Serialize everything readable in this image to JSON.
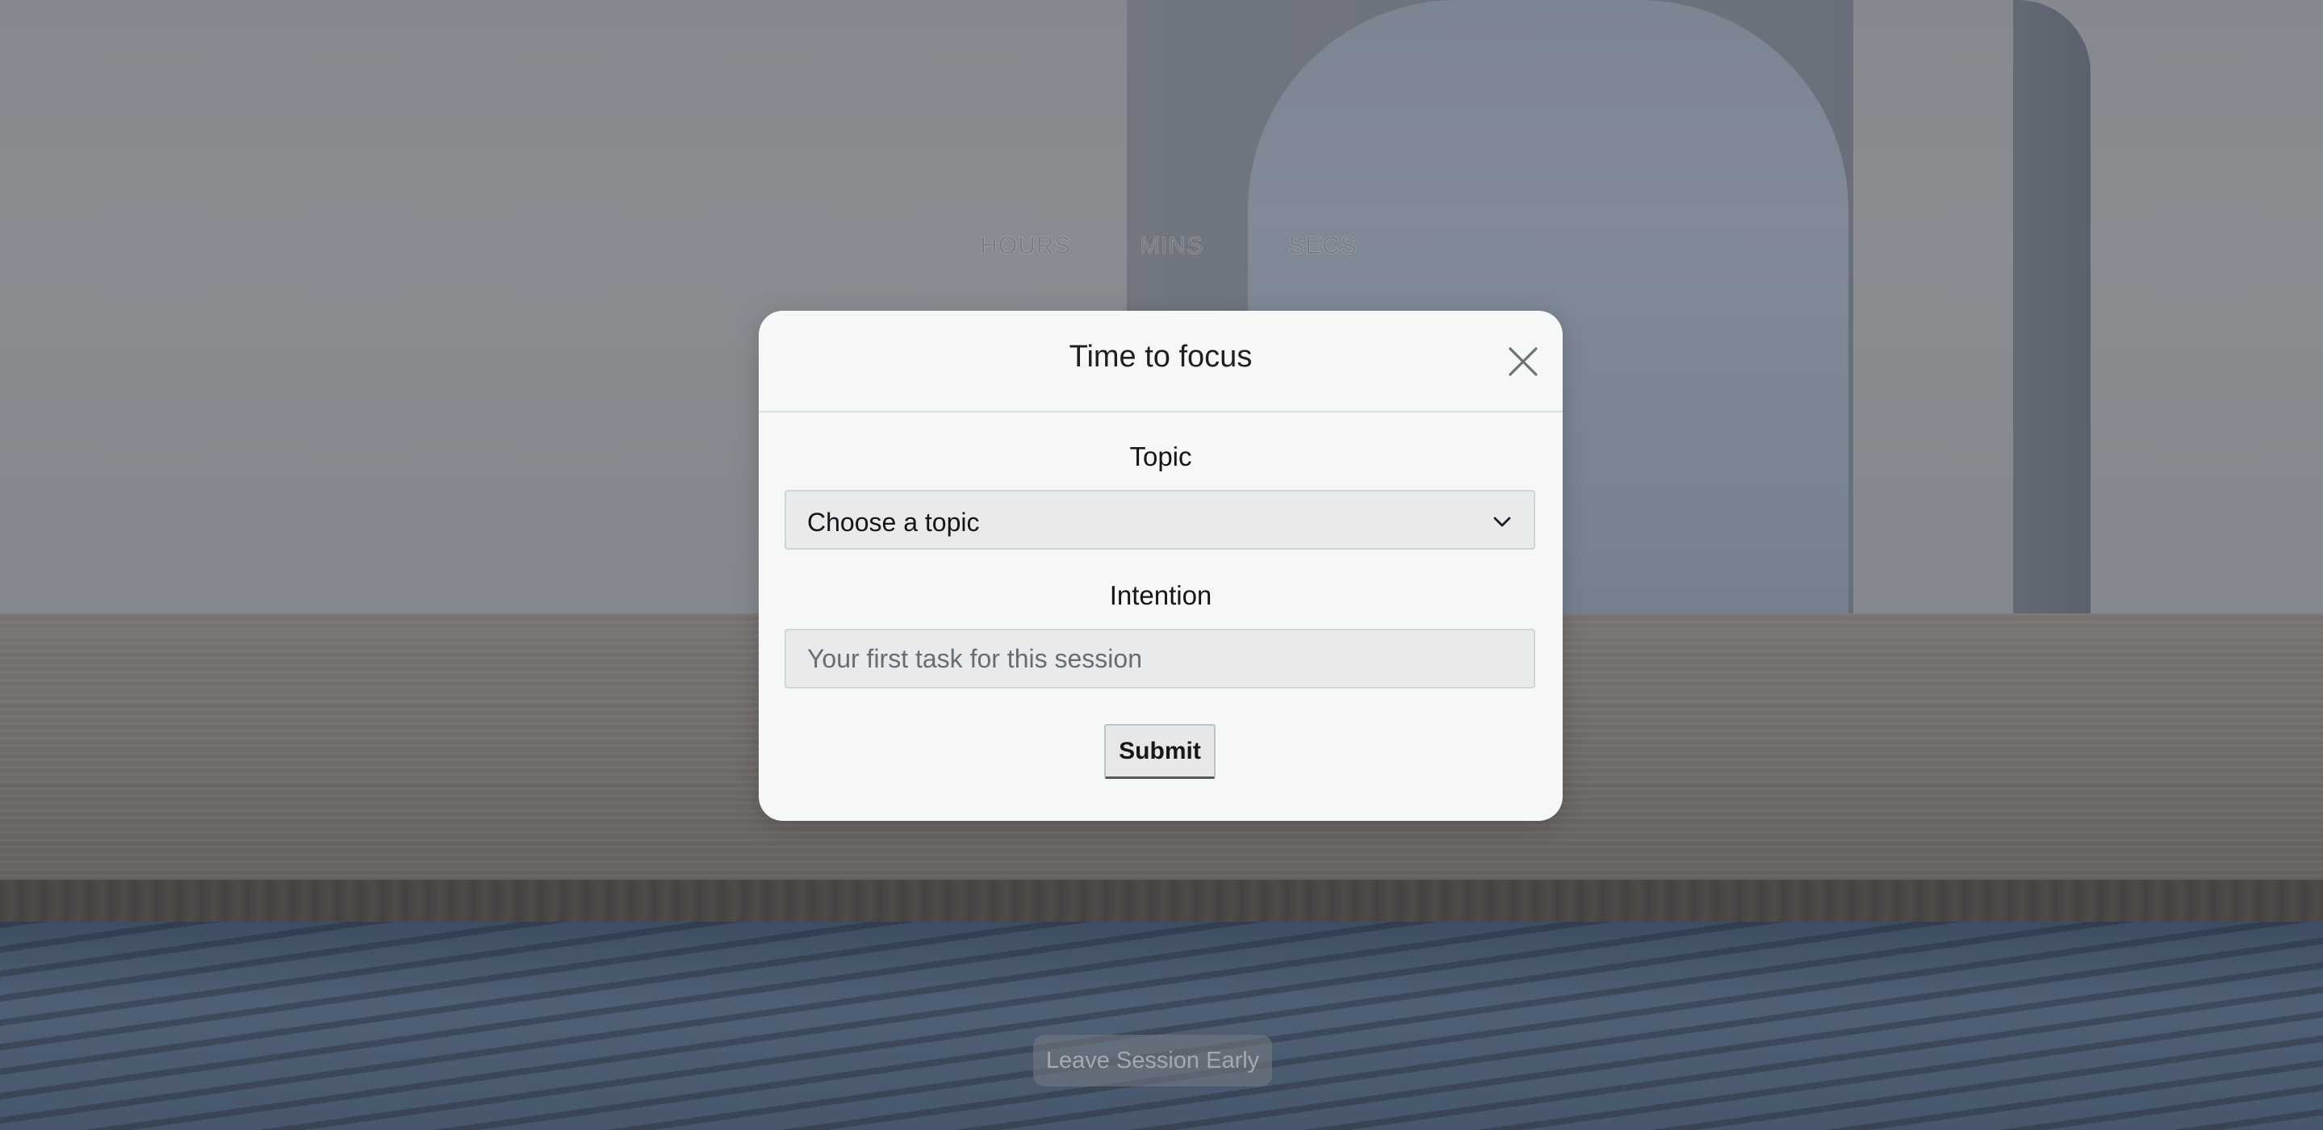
{
  "timer": {
    "hours_label": "HOURS",
    "mins_label": "MINS",
    "secs_label": "SECS"
  },
  "modal": {
    "title": "Time to focus",
    "close_icon": "close-icon",
    "topic": {
      "label": "Topic",
      "selected_value": "Choose a topic",
      "chevron_icon": "chevron-down-icon"
    },
    "intention": {
      "label": "Intention",
      "value": "",
      "placeholder": "Your first task for this session"
    },
    "submit_label": "Submit"
  },
  "footer": {
    "leave_label": "Leave Session Early"
  },
  "colors": {
    "modal_background": "#f6f7f7",
    "input_background": "#e9eaeb",
    "overlay": "rgba(40,44,50,0.42)"
  }
}
